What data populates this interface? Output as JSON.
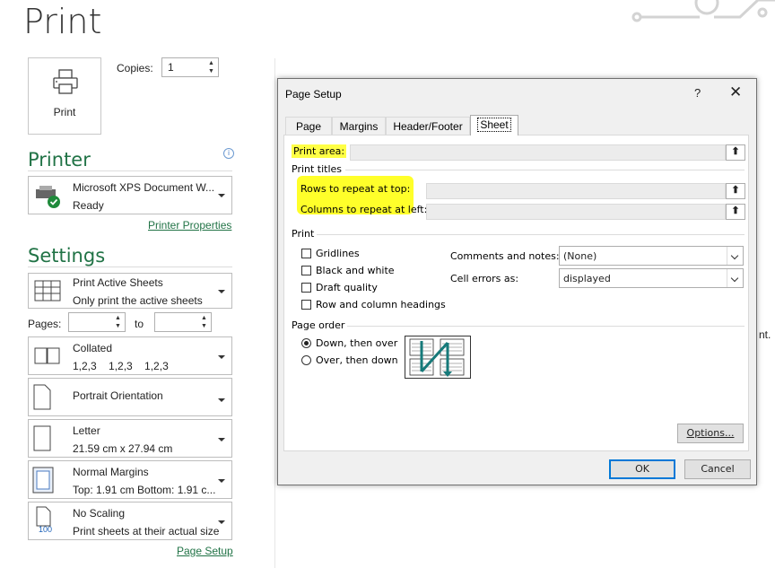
{
  "page": {
    "title": "Print",
    "print_button_label": "Print",
    "copies_label": "Copies:",
    "copies_value": "1"
  },
  "printer": {
    "header": "Printer",
    "name": "Microsoft XPS Document W...",
    "status": "Ready",
    "properties_link": "Printer Properties"
  },
  "settings": {
    "header": "Settings",
    "scope": {
      "title": "Print Active Sheets",
      "subtitle": "Only print the active sheets"
    },
    "pages_label": "Pages:",
    "pages_to_label": "to",
    "collation": {
      "title": "Collated",
      "subtitle": "1,2,3    1,2,3    1,2,3"
    },
    "orientation": {
      "title": "Portrait Orientation"
    },
    "paper": {
      "title": "Letter",
      "subtitle": "21.59 cm x 27.94 cm"
    },
    "margins": {
      "title": "Normal Margins",
      "subtitle": "Top: 1.91 cm Bottom: 1.91 c..."
    },
    "scaling": {
      "title": "No Scaling",
      "subtitle": "Print sheets at their actual size",
      "icon_text": "100"
    },
    "page_setup_link": "Page Setup"
  },
  "dialog": {
    "title": "Page Setup",
    "help": "?",
    "close": "✕",
    "tabs": [
      {
        "label": "Page"
      },
      {
        "label": "Margins"
      },
      {
        "label": "Header/Footer"
      },
      {
        "label": "Sheet"
      }
    ],
    "print_area_label": "Print area:",
    "print_titles_label": "Print titles",
    "rows_repeat_label": "Rows to repeat at top:",
    "cols_repeat_label": "Columns to repeat at left:",
    "print_group_label": "Print",
    "checkboxes": {
      "gridlines": "Gridlines",
      "black_white": "Black and white",
      "draft": "Draft quality",
      "headings": "Row and column headings"
    },
    "comments_label": "Comments and notes:",
    "comments_value": "(None)",
    "cell_errors_label": "Cell errors as:",
    "cell_errors_value": "displayed",
    "page_order_label": "Page order",
    "order_down": "Down, then over",
    "order_over": "Over, then down",
    "options_button": "Options...",
    "ok_button": "OK",
    "cancel_button": "Cancel"
  },
  "background_fragment": "nt."
}
